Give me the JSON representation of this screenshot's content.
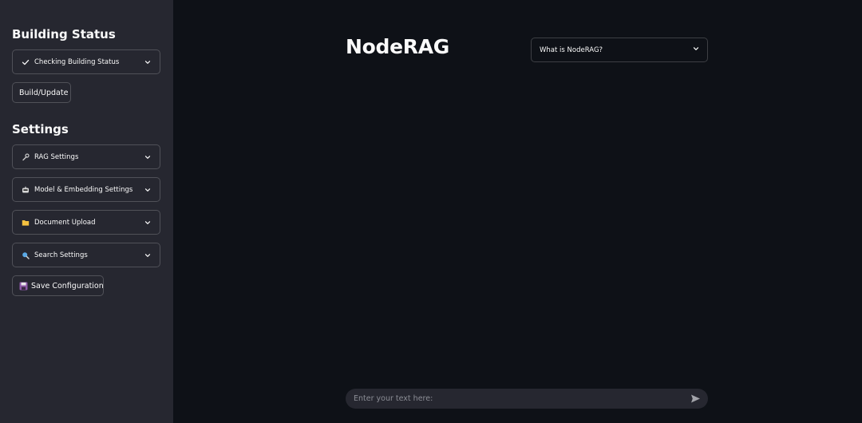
{
  "sidebar": {
    "building_status_heading": "Building Status",
    "status_expander_label": "Checking Building Status",
    "build_button_label": "Build/Update",
    "settings_heading": "Settings",
    "expanders": [
      {
        "label": "RAG Settings",
        "icon": "wrench-icon"
      },
      {
        "label": "Model & Embedding Settings",
        "icon": "robot-icon"
      },
      {
        "label": "Document Upload",
        "icon": "folder-icon"
      },
      {
        "label": "Search Settings",
        "icon": "magnifier-icon"
      }
    ],
    "save_button_label": "Save Configuration",
    "save_icon": "floppy-disk-icon"
  },
  "main": {
    "title": "NodeRAG",
    "info_expander_label": "What is NodeRAG?",
    "chat_placeholder": "Enter your text here:",
    "send_icon": "send-icon"
  },
  "colors": {
    "background": "#0e1117",
    "sidebar": "#262730",
    "text": "#fafafa",
    "placeholder": "#8b8d95"
  }
}
